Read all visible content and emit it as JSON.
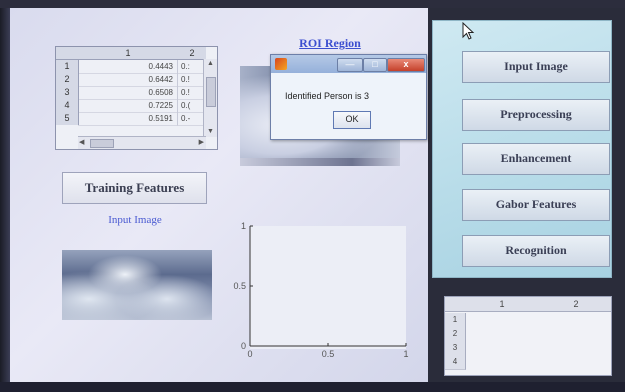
{
  "features_table": {
    "columns": [
      "1",
      "2"
    ],
    "rows": [
      {
        "index": "1",
        "c1": "0.4443",
        "c2": "0.:"
      },
      {
        "index": "2",
        "c1": "0.6442",
        "c2": "0.!"
      },
      {
        "index": "3",
        "c1": "0.6508",
        "c2": "0.!"
      },
      {
        "index": "4",
        "c1": "0.7225",
        "c2": "0.("
      },
      {
        "index": "5",
        "c1": "0.5191",
        "c2": "0.-"
      }
    ]
  },
  "roi": {
    "title": "ROI Region"
  },
  "dialog": {
    "message": "Identified Person is 3",
    "ok_label": "OK",
    "minimize_glyph": "—",
    "restore_glyph": "□",
    "close_glyph": "x"
  },
  "training_button": {
    "label": "Training Features"
  },
  "input_image": {
    "title": "Input Image"
  },
  "chart_data": {
    "type": "line",
    "title": "",
    "xlabel": "",
    "ylabel": "",
    "xlim": [
      0,
      1
    ],
    "ylim": [
      0,
      1
    ],
    "series": [],
    "x_ticks": [
      "0",
      "0.5",
      "1"
    ],
    "y_ticks": [
      "0",
      "0.5",
      "1"
    ],
    "grid": false
  },
  "menu": {
    "input_image": "Input Image",
    "preprocessing": "Preprocessing",
    "enhancement": "Enhancement",
    "gabor_features": "Gabor Features",
    "recognition": "Recognition"
  },
  "result_table": {
    "columns": [
      "1",
      "2"
    ],
    "rows": [
      "1",
      "2",
      "3",
      "4"
    ]
  },
  "colors": {
    "title_blue": "#3c4fd0",
    "panel_cyan": "#b6dbe8",
    "figure_bg": "#e3e4f2"
  }
}
